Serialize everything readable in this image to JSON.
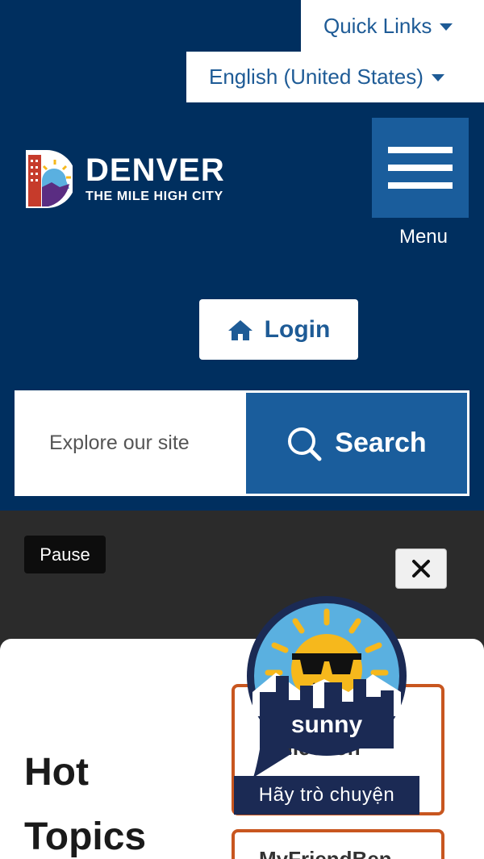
{
  "header": {
    "quick_links": "Quick Links",
    "language": "English (United States)",
    "logo": {
      "title": "DENVER",
      "subtitle": "THE MILE HIGH CITY"
    },
    "menu_label": "Menu",
    "login_label": "Login",
    "search": {
      "placeholder": "Explore our site",
      "button_label": "Search"
    }
  },
  "banner": {
    "pause_label": "Pause",
    "close_symbol": "✕"
  },
  "content": {
    "section_title": "Hot Topics",
    "topics": [
      "Collection",
      "MyFriendBen"
    ]
  },
  "chat": {
    "bot_name": "sunny",
    "prompt": "Hãy trò chuyện"
  },
  "colors": {
    "header_bg": "#002f5f",
    "accent_blue": "#1a5d9c",
    "link_blue": "#1e5b96",
    "topic_border": "#c8561f",
    "chat_navy": "#1b2a54",
    "sun_yellow": "#f6b81c"
  },
  "icons": [
    "chevron-down-icon",
    "hamburger-icon",
    "home-icon",
    "search-icon",
    "close-icon",
    "denver-logo-icon",
    "sunny-chatbot-icon"
  ]
}
